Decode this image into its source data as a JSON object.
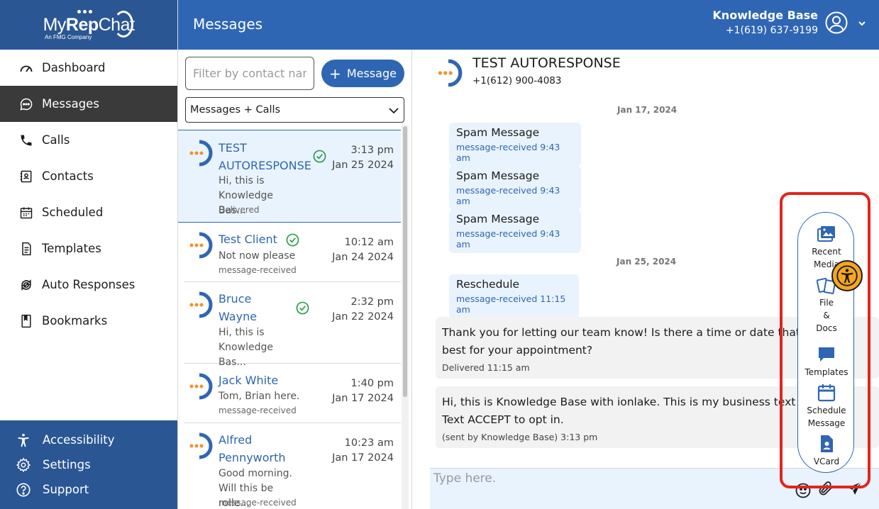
{
  "app": {
    "logo_text_pre": "My",
    "logo_text_bold": "Rep",
    "logo_text_post": "Chat",
    "logo_sub": "An FMG Company",
    "brand_blue": "#2f66b3",
    "sidebar_blue": "#2a5694",
    "accent_orange": "#f0922b"
  },
  "sidebar": {
    "items": [
      {
        "label": "Dashboard",
        "icon": "gauge-icon"
      },
      {
        "label": "Messages",
        "icon": "chat-bubble-icon",
        "active": true
      },
      {
        "label": "Calls",
        "icon": "phone-icon"
      },
      {
        "label": "Contacts",
        "icon": "contact-card-icon"
      },
      {
        "label": "Scheduled",
        "icon": "calendar-icon"
      },
      {
        "label": "Templates",
        "icon": "document-icon"
      },
      {
        "label": "Auto Responses",
        "icon": "refresh-icon"
      },
      {
        "label": "Bookmarks",
        "icon": "bookmark-icon"
      }
    ],
    "bottom": [
      {
        "label": "Accessibility",
        "icon": "accessibility-icon"
      },
      {
        "label": "Settings",
        "icon": "gear-icon"
      },
      {
        "label": "Support",
        "icon": "help-icon"
      }
    ]
  },
  "header": {
    "title": "Messages",
    "account_name": "Knowledge Base",
    "account_phone": "+1(619) 637-9199"
  },
  "list": {
    "filter_placeholder": "Filter by contact name",
    "new_message_label": "Message",
    "type_filter": "Messages + Calls",
    "conversations": [
      {
        "name_line1": "TEST",
        "name_line2": "AUTORESPONSE",
        "time": "3:13 pm",
        "date": "Jan 25 2024",
        "preview_line1": "Hi, this is",
        "preview_line2": "Knowledge Bas...",
        "status": "Delivered"
      },
      {
        "name_line1": "Test Client",
        "time": "10:12 am",
        "date": "Jan 24 2024",
        "preview_line1": "Not now please",
        "status": "message-received"
      },
      {
        "name_line1": "Bruce",
        "name_line2": "Wayne",
        "time": "2:32 pm",
        "date": "Jan 22 2024",
        "preview_line1": "Hi, this is",
        "preview_line2": "Knowledge Bas..."
      },
      {
        "name_line1": "Jack White",
        "time": "1:40 pm",
        "date": "Jan 17 2024",
        "preview_line1": "Tom, Brian here.",
        "status": "message-received"
      },
      {
        "name_line1": "Alfred",
        "name_line2": "Pennyworth",
        "time": "10:23 am",
        "date": "Jan 17 2024",
        "preview_line1": "Good morning.",
        "preview_line2": "Will this be rolle...",
        "status": "message-received"
      }
    ]
  },
  "chat": {
    "contact_name": "TEST AUTORESPONSE",
    "contact_phone": "+1(612) 900-4083",
    "date1": "Jan 17, 2024",
    "date2": "Jan 25, 2024",
    "incoming": [
      {
        "text": "Spam Message",
        "meta": "message-received 9:43 am"
      },
      {
        "text": "Spam Message",
        "meta": "message-received 9:43 am"
      },
      {
        "text": "Spam Message",
        "meta": "message-received 9:43 am"
      },
      {
        "text": "Reschedule",
        "meta": "message-received 11:15 am"
      }
    ],
    "outgoing": [
      {
        "line1": "Thank you for letting our team know! Is there a time or date that",
        "line2": "best for your appointment?",
        "meta": "Delivered 11:15 am"
      },
      {
        "line1": "Hi, this is Knowledge Base with ionlake. This is my business text",
        "line2": "Text ACCEPT to opt in.",
        "meta": "(sent by Knowledge Base)  3:13 pm"
      }
    ],
    "compose_placeholder": "Type here."
  },
  "attach_panel": {
    "recent_media_l1": "Recent",
    "recent_media_l2": "Media",
    "file_l1": "File",
    "file_l2": "&",
    "file_l3": "Docs",
    "templates": "Templates",
    "schedule_l1": "Schedule",
    "schedule_l2": "Message",
    "vcard": "VCard",
    "highlight_color": "#e5231b"
  }
}
